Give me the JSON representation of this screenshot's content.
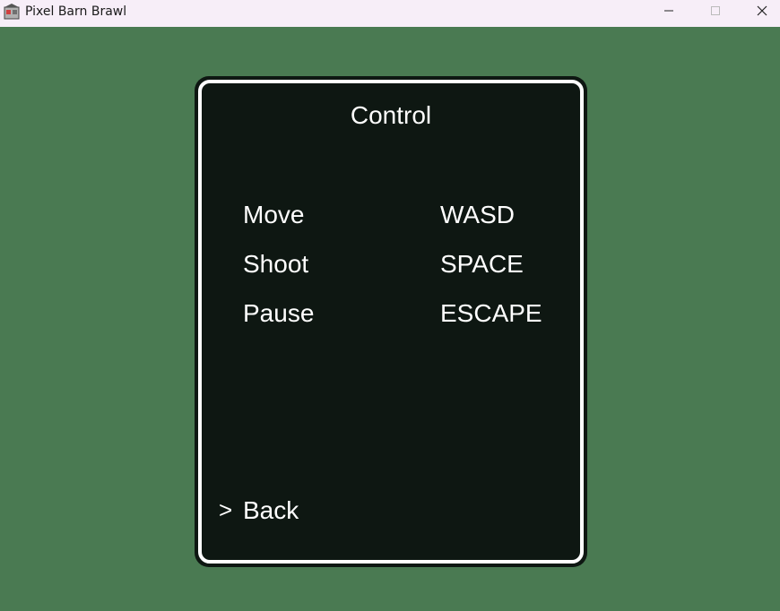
{
  "window": {
    "title": "Pixel Barn Brawl",
    "app_icon": "app-icon",
    "controls": [
      "minimize-icon",
      "maximize-icon",
      "close-icon"
    ]
  },
  "colors": {
    "background": "#4a7a52",
    "panel": "#0e1712",
    "panel_border": "#ffffff",
    "text": "#ffffff"
  },
  "menu": {
    "title": "Control",
    "bindings": [
      {
        "action": "Move",
        "key": "WASD"
      },
      {
        "action": "Shoot",
        "key": "SPACE"
      },
      {
        "action": "Pause",
        "key": "ESCAPE"
      }
    ],
    "cursor": ">",
    "back_label": "Back"
  }
}
